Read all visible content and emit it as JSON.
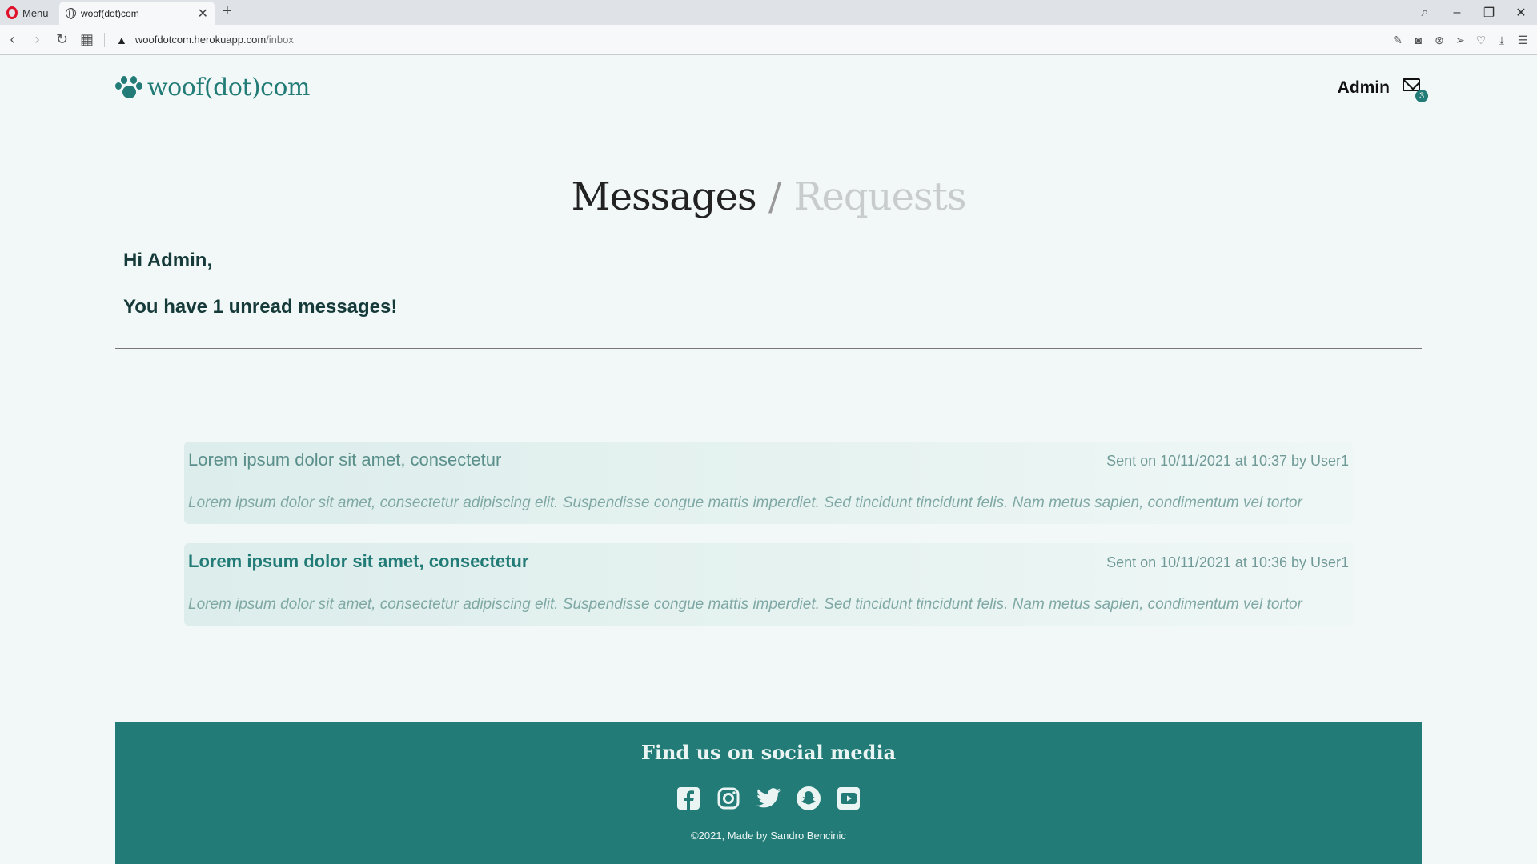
{
  "browser": {
    "menu_label": "Menu",
    "tab_title": "woof(dot)com",
    "url_host": "woofdotcom.herokuapp.com",
    "url_path": "/inbox"
  },
  "header": {
    "logo_text": "woof(dot)com",
    "user_name": "Admin",
    "mail_count": "3"
  },
  "page": {
    "title_messages": "Messages",
    "title_separator": "/",
    "title_requests": "Requests",
    "greeting": "Hi Admin,",
    "unread_notice": "You have 1 unread messages!"
  },
  "messages": [
    {
      "subject": "Lorem ipsum dolor sit amet, consectetur",
      "meta": "Sent on 10/11/2021 at 10:37 by User1",
      "body": "Lorem ipsum dolor sit amet, consectetur adipiscing elit. Suspendisse congue mattis imperdiet. Sed tincidunt tincidunt felis. Nam metus sapien, condimentum vel tortor",
      "unread": false
    },
    {
      "subject": "Lorem ipsum dolor sit amet, consectetur",
      "meta": "Sent on 10/11/2021 at 10:36 by User1",
      "body": "Lorem ipsum dolor sit amet, consectetur adipiscing elit. Suspendisse congue mattis imperdiet. Sed tincidunt tincidunt felis. Nam metus sapien, condimentum vel tortor",
      "unread": true
    }
  ],
  "footer": {
    "title": "Find us on social media",
    "socials": [
      "facebook-icon",
      "instagram-icon",
      "twitter-icon",
      "snapchat-icon",
      "youtube-icon"
    ],
    "copyright": "©2021, Made by Sandro Bencinic"
  },
  "colors": {
    "accent": "#227b76",
    "background": "#f1f8f7"
  }
}
